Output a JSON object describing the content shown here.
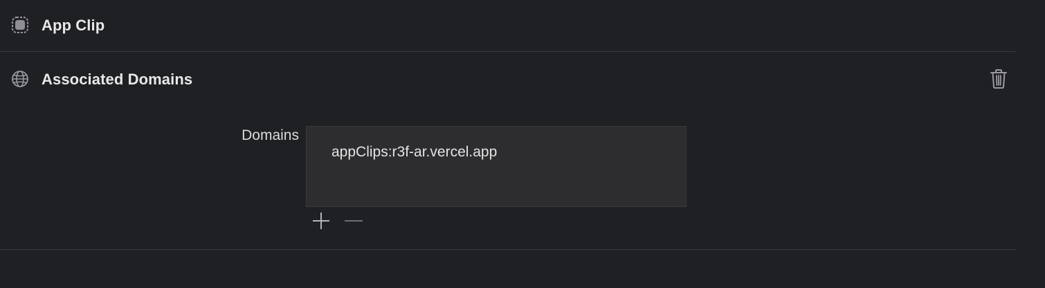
{
  "capabilities": {
    "app_clip": {
      "title": "App Clip",
      "icon": "app-clip-icon"
    },
    "associated_domains": {
      "title": "Associated Domains",
      "icon": "globe-icon",
      "delete_icon": "trash-icon",
      "field_label": "Domains",
      "domains": [
        "appClips:r3f-ar.vercel.app"
      ],
      "add_icon": "plus-icon",
      "remove_icon": "minus-icon"
    }
  },
  "colors": {
    "background": "#1f2024",
    "list_background": "#2d2d2f",
    "divider": "#3a3b3f",
    "text": "#e6e6e6",
    "icon": "#9a9a9e"
  }
}
